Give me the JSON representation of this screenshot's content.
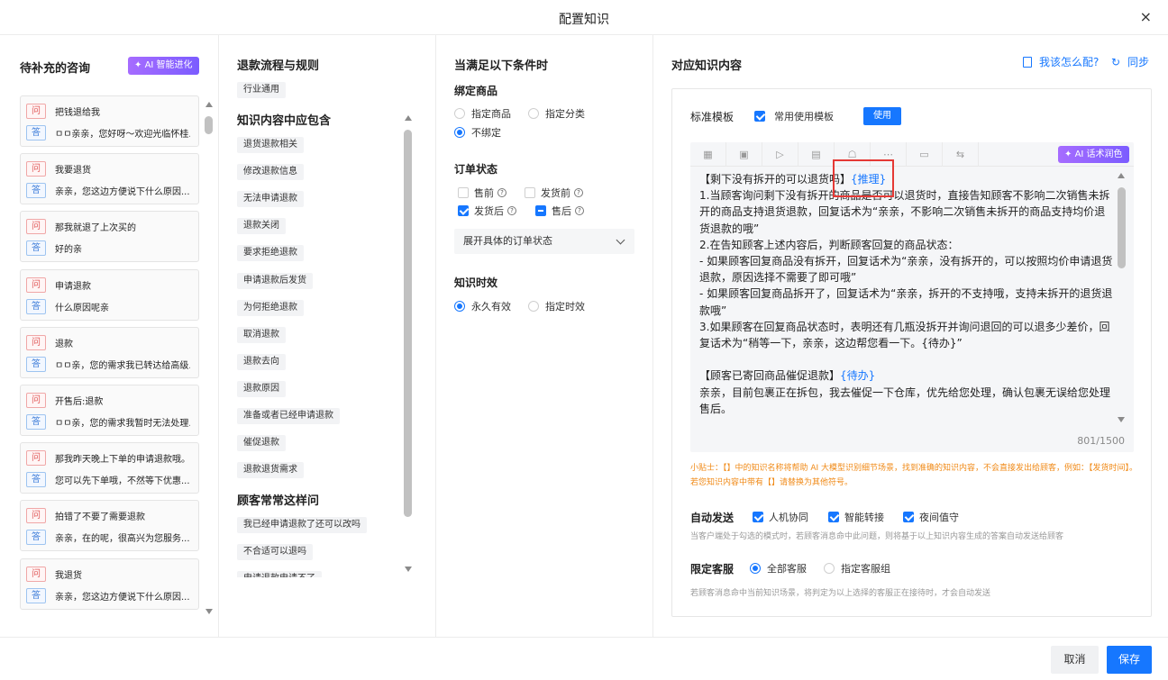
{
  "dialog": {
    "title": "配置知识",
    "close_icon": "×"
  },
  "col1": {
    "title": "待补充的咨询",
    "ai_button": "AI 智能进化",
    "q_tag": "问",
    "a_tag": "答",
    "cards": [
      {
        "q": "把钱退给我",
        "a": "ㅁㅁ亲亲，您好呀～欢迎光临怀桂..."
      },
      {
        "q": "我要退货",
        "a": "亲亲，您这边方便说下什么原因..."
      },
      {
        "q": "那我就退了上次买的",
        "a": "好的亲"
      },
      {
        "q": "申请退款",
        "a": "什么原因呢亲"
      },
      {
        "q": "退款",
        "a": "ㅁㅁ亲，您的需求我已转达给高级..."
      },
      {
        "q": "开售后:退款",
        "a": "ㅁㅁ亲，您的需求我暂时无法处理..."
      },
      {
        "q": "那我昨天晚上下单的申请退款哦。",
        "a": "您可以先下单哦，不然等下优惠..."
      },
      {
        "q": "拍错了不要了需要退款",
        "a": "亲亲，在的呢，很高兴为您服务..."
      },
      {
        "q": "我退货",
        "a": "亲亲，您这边方便说下什么原因..."
      }
    ]
  },
  "col2": {
    "title": "退款流程与规则",
    "scope_chip": "行业通用",
    "section1": "知识内容中应包含",
    "chips1": [
      "退货退款相关",
      "修改退款信息",
      "无法申请退款",
      "退款关闭",
      "要求拒绝退款",
      "申请退款后发货",
      "为何拒绝退款",
      "取消退款",
      "退款去向",
      "退款原因",
      "准备或者已经申请退款",
      "催促退款",
      "退款退货需求"
    ],
    "section2": "顾客常常这样问",
    "chips2": [
      "我已经申请退款了还可以改吗",
      "不合适可以退吗",
      "申请退款申请不了"
    ]
  },
  "col3": {
    "title": "当满足以下条件时",
    "bind_product": {
      "label": "绑定商品",
      "options": [
        "指定商品",
        "指定分类",
        "不绑定"
      ]
    },
    "order_status": {
      "label": "订单状态",
      "options": [
        "售前",
        "发货前",
        "发货后",
        "售后"
      ],
      "select_text": "展开具体的订单状态"
    },
    "validity": {
      "label": "知识时效",
      "options": [
        "永久有效",
        "指定时效"
      ]
    }
  },
  "col4": {
    "title": "对应知识内容",
    "how_link": "我该怎么配?",
    "sync_link": "同步",
    "template_label": "标准模板",
    "template_check": "常用使用模板",
    "use_button": "使用",
    "ai_polish": "AI 话术润色",
    "toolbar_icons": [
      "table-icon",
      "image-icon",
      "video-icon",
      "file-icon",
      "robot-icon",
      "ellipsis-icon",
      "screen-icon",
      "transfer-icon"
    ],
    "editor": {
      "p1_head": "【剩下没有拆开的可以退货吗】",
      "p1_var": "{推理}",
      "p1_lines": [
        "1.当顾客询问剩下没有拆开的商品是否可以退货时，直接告知顾客不影响二次销售未拆开的商品支持退货退款，回复话术为“亲亲，不影响二次销售未拆开的商品支持均价退货退款的哦”",
        "2.在告知顾客上述内容后，判断顾客回复的商品状态：",
        "- 如果顾客回复商品没有拆开，回复话术为“亲亲，没有拆开的，可以按照均价申请退货退款，原因选择不需要了即可哦”",
        "- 如果顾客回复商品拆开了，回复话术为“亲亲，拆开的不支持哦，支持未拆开的退货退款哦”",
        "3.如果顾客在回复商品状态时，表明还有几瓶没拆开并询问退回的可以退多少差价，回复话术为“稍等一下，亲亲，这边帮您看一下。{待办}”"
      ],
      "p2_head": "【顾客已寄回商品催促退款】",
      "p2_var": "{待办}",
      "p2_line": "亲亲，目前包裹正在拆包，我去催促一下仓库，优先给您处理，确认包裹无误给您处理售后。",
      "counter": "801/1500"
    },
    "tip": "小贴士：【】中的知识名称将帮助 AI 大模型识别细节场景，找到准确的知识内容，不会直接发出给顾客，例如：【发货时间】。若您知识内容中带有【】请替换为其他符号。",
    "auto_send": {
      "label": "自动发送",
      "options": [
        "人机协同",
        "智能转接",
        "夜间值守"
      ],
      "desc": "当客户端处于勾选的模式时，若顾客消息命中此问题，则将基于以上知识内容生成的答案自动发送给顾客"
    },
    "limit_staff": {
      "label": "限定客服",
      "options": [
        "全部客服",
        "指定客服组"
      ],
      "desc": "若顾客消息命中当前知识场景，将判定为以上选择的客服正在接待时，才会自动发送"
    }
  },
  "footer": {
    "cancel": "取消",
    "save": "保存"
  },
  "colors": {
    "accent": "#1677ff",
    "ai_gradient": "#8b5cf6",
    "highlight_box": "#e53935",
    "tip": "#f08a17"
  }
}
